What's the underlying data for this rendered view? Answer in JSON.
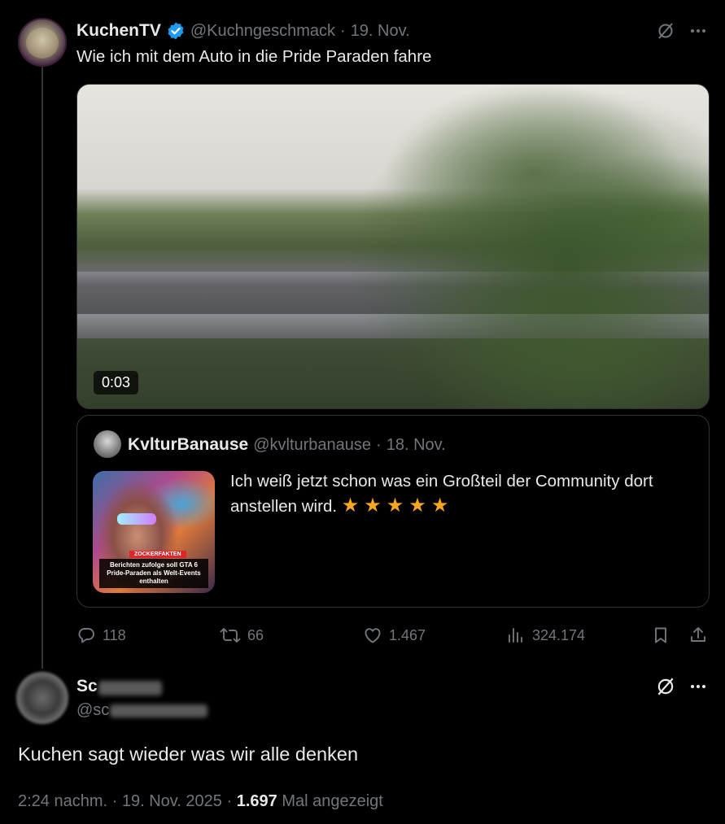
{
  "thread": {
    "tweet": {
      "author_name": "KuchenTV",
      "handle": "@Kuchngeschmack",
      "separator": "·",
      "date": "19. Nov.",
      "text": "Wie ich mit dem Auto in die Pride Paraden fahre",
      "video_duration": "0:03",
      "quote": {
        "author_name": "KvlturBanause",
        "handle": "@kvlturbanause",
        "separator": "·",
        "date": "18. Nov.",
        "text": "Ich weiß jetzt schon was ein Großteil der Community dort anstellen wird.",
        "stars": "★★★★★",
        "thumbnail_tag": "ZOCKERFAKTEN",
        "thumbnail_caption": "Berichten zufolge soll GTA 6 Pride-Paraden als Welt-Events enthalten"
      },
      "actions": {
        "replies": "118",
        "reposts": "66",
        "likes": "1.467",
        "views": "324.174"
      }
    },
    "reply": {
      "author_name_visible": "Sc",
      "handle_visible": "@sc",
      "text": "Kuchen sagt wieder was wir alle denken",
      "time": "2:24 nachm.",
      "separator": "·",
      "date": "19. Nov. 2025",
      "view_count": "1.697",
      "views_label": "Mal angezeigt"
    }
  },
  "colors": {
    "background": "#000000",
    "text": "#e7e9ea",
    "muted": "#71767b",
    "border": "#2f3336",
    "verified": "#1d9bf0",
    "stars": "#f5a623"
  },
  "icons": [
    "verified-badge-icon",
    "grok-icon",
    "more-icon",
    "reply-icon",
    "repost-icon",
    "like-icon",
    "views-icon",
    "bookmark-icon",
    "share-icon"
  ]
}
